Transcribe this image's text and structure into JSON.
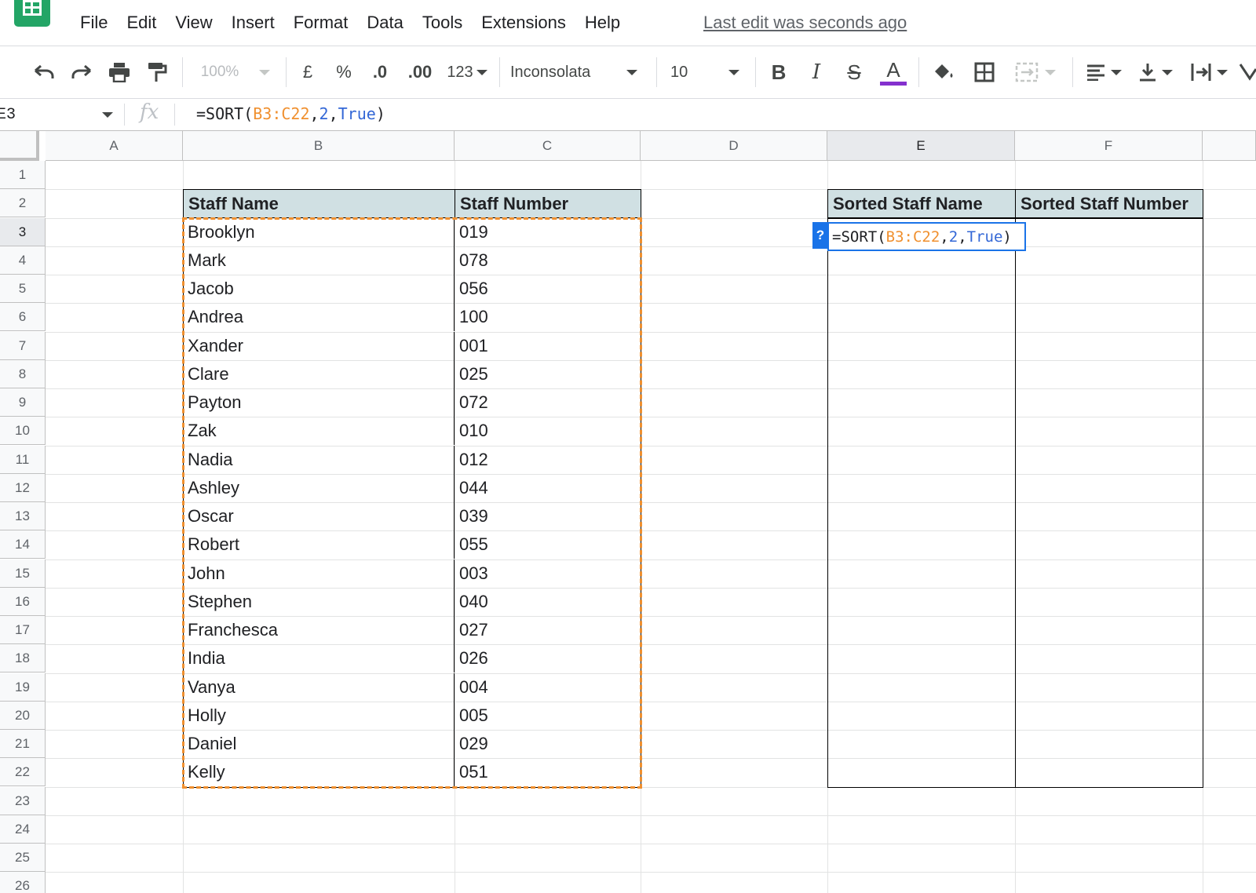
{
  "menu": {
    "items": [
      "File",
      "Edit",
      "View",
      "Insert",
      "Format",
      "Data",
      "Tools",
      "Extensions",
      "Help"
    ],
    "last_edit": "Last edit was seconds ago"
  },
  "toolbar": {
    "zoom": "100%",
    "currency": "£",
    "percent": "%",
    "decrease_decimal": ".0",
    "increase_decimal": ".00",
    "more_formats": "123",
    "font": "Inconsolata",
    "font_size": "10",
    "bold": "B",
    "italic": "I",
    "strike": "S",
    "text_color_glyph": "A",
    "text_color": "#8430ce"
  },
  "formula_bar": {
    "cell_ref": "E3",
    "fx": "fx",
    "formula_prefix": "=SORT(",
    "formula_range": "B3:C22",
    "formula_sep1": ",",
    "formula_col": "2",
    "formula_sep2": ",",
    "formula_flag": "True",
    "formula_suffix": ")"
  },
  "columns": [
    "A",
    "B",
    "C",
    "D",
    "E",
    "F"
  ],
  "rows": [
    "1",
    "2",
    "3",
    "4",
    "5",
    "6",
    "7",
    "8",
    "9",
    "10",
    "11",
    "12",
    "13",
    "14",
    "15",
    "16",
    "17",
    "18",
    "19",
    "20",
    "21",
    "22",
    "23",
    "24",
    "25",
    "26"
  ],
  "table": {
    "headers": [
      "Staff Name",
      "Staff Number"
    ],
    "rows": [
      [
        "Brooklyn",
        "019"
      ],
      [
        "Mark",
        "078"
      ],
      [
        "Jacob",
        "056"
      ],
      [
        "Andrea",
        "100"
      ],
      [
        "Xander",
        "001"
      ],
      [
        "Clare",
        "025"
      ],
      [
        "Payton",
        "072"
      ],
      [
        "Zak",
        "010"
      ],
      [
        "Nadia",
        "012"
      ],
      [
        "Ashley",
        "044"
      ],
      [
        "Oscar",
        "039"
      ],
      [
        "Robert",
        "055"
      ],
      [
        "John",
        "003"
      ],
      [
        "Stephen",
        "040"
      ],
      [
        "Franchesca",
        "027"
      ],
      [
        "India",
        "026"
      ],
      [
        "Vanya",
        "004"
      ],
      [
        "Holly",
        "005"
      ],
      [
        "Daniel",
        "029"
      ],
      [
        "Kelly",
        "051"
      ]
    ]
  },
  "sorted": {
    "headers": [
      "Sorted Staff Name",
      "Sorted Staff Number"
    ],
    "help_badge": "?"
  },
  "colors": {
    "header_fill": "#d0e0e3",
    "copy_range": "#f0902f",
    "selection": "#1a73e8"
  }
}
